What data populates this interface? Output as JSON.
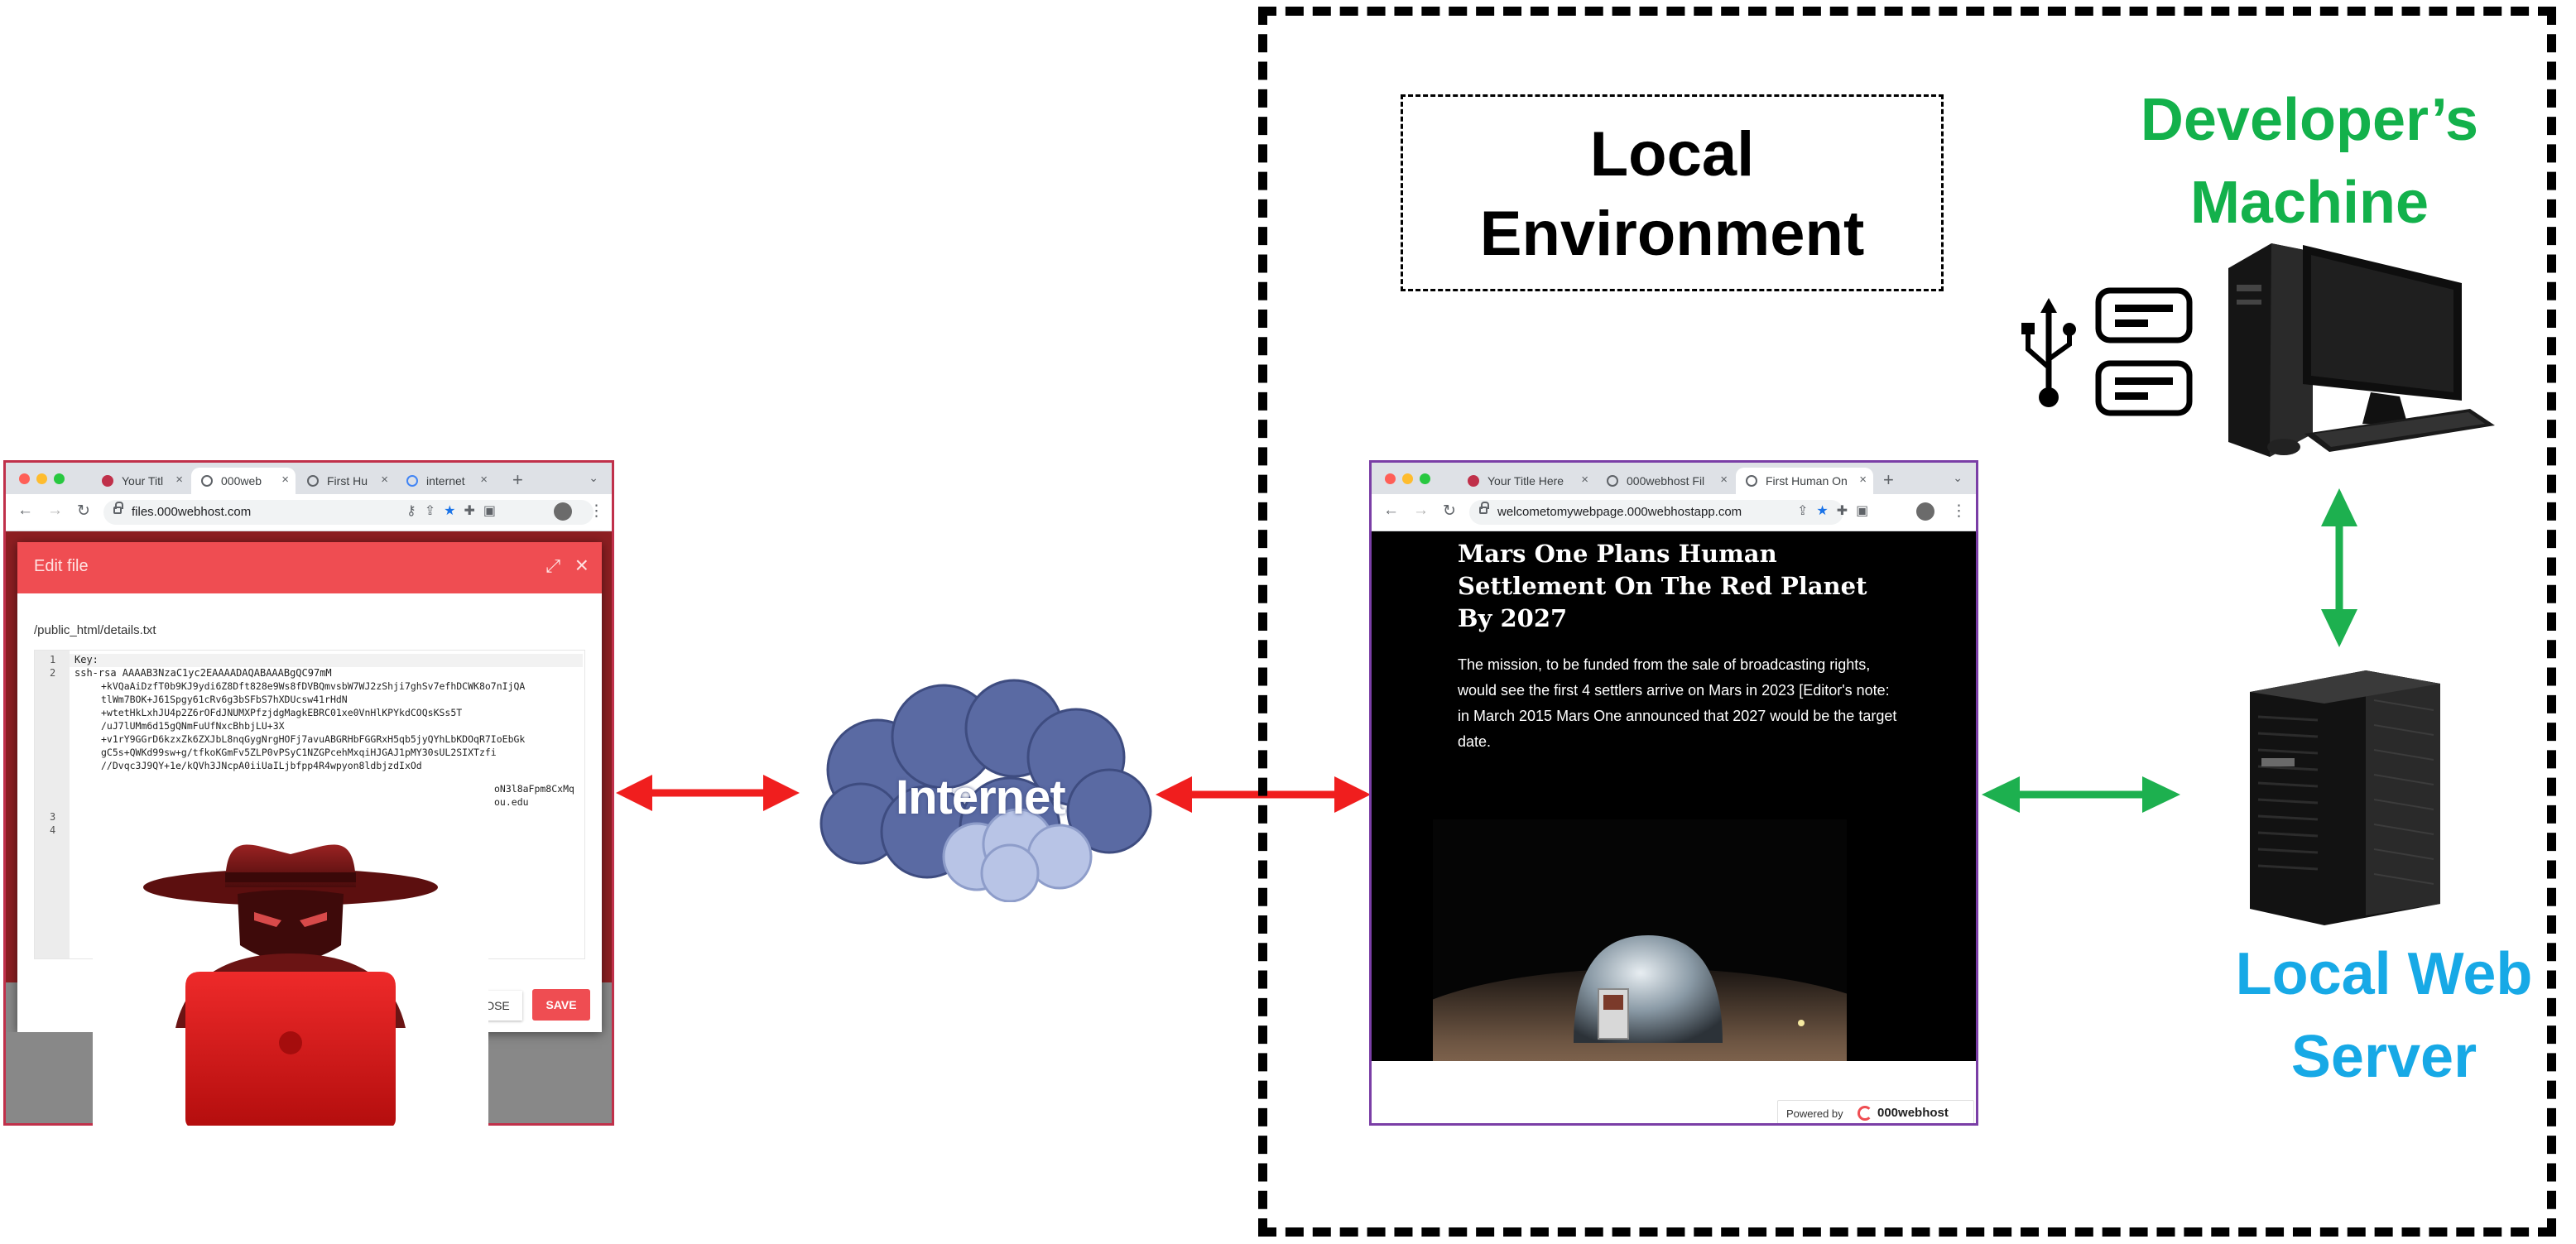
{
  "colors": {
    "red_arrow": "#f01e1e",
    "green_arrow": "#1db04f",
    "developer_label": "#13b14b",
    "server_label": "#17a9e6",
    "edit_header": "#ef4d52",
    "save_button": "#ef4d52",
    "cloud": "#5a6aa3"
  },
  "left_browser": {
    "tabs": [
      "Your Titl",
      "000web",
      "First Hu",
      "internet"
    ],
    "url": "files.000webhost.com",
    "dialog": {
      "title": "Edit file",
      "path": "/public_html/details.txt",
      "line_numbers": [
        "1",
        "2",
        "3",
        "4"
      ],
      "code_lines": [
        "Key:",
        "ssh-rsa AAAAB3NzaC1yc2EAAAADAQABAAABgQC97mM",
        "+kVQaAiDzfT0b9KJ9ydi6Z8Dft828e9Ws8fDVBQmvsbW7WJ2zShji7ghSv7efhDCWK8o7nIjQA",
        "tlWm7BOK+J61Spgy61cRv6g3bSFbS7hXDUcsw41rHdN",
        "+wtetHkLxhJU4p2Z6rOFdJNUMXPfzjdgMagkEBRC01xe0VnHlKPYkdCOQsKSs5T",
        "/uJ7lUMm6d15gQNmFuUfNxcBhbjLU+3X",
        "+v1rY9GGrD6kzxZk6ZXJbL8nqGygNrgHOFj7avuABGRHbFGGRxH5qb5jyQYhLbKDOqR7IoEbGk",
        "gC5s+QWKd99sw+g/tfkoKGmFv5ZLP0vPSyC1NZGPcehMxqiHJGAJ1pMY30sUL2SIXTzfi",
        "//Dvqc3J9QY+1e/kQVh3JNcpA0iiUaILjbfpp4R4wpyon8ldbjzdIxOd",
        "oN3l8aFpm8CxMq",
        "ou.edu"
      ],
      "close_label": "OSE",
      "save_label": "SAVE"
    }
  },
  "cloud_label": "Internet",
  "local_environment_label_line1": "Local",
  "local_environment_label_line2": "Environment",
  "developer_label_line1": "Developer’s",
  "developer_label_line2": "Machine",
  "server_label_line1": "Local Web",
  "server_label_line2": "Server",
  "right_browser": {
    "tabs": [
      "Your Title Here",
      "000webhost Fil",
      "First Human On"
    ],
    "url": "welcometomywebpage.000webhostapp.com",
    "headline": "Mars One Plans Human Settlement On The Red Planet By 2027",
    "body": "The mission, to be funded from the sale of broadcasting rights, would see the first 4 settlers arrive on Mars in 2023 [Editor's note: in March 2015 Mars One announced that 2027 would be the target date.",
    "powered_by": "Powered by",
    "host_brand": "000webhost"
  }
}
